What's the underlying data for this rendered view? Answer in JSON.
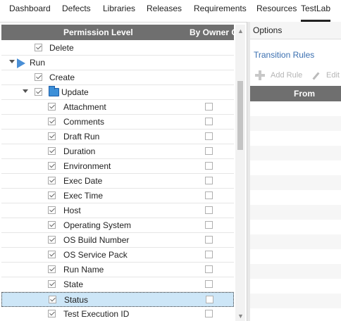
{
  "tabs": [
    {
      "label": "Dashboard"
    },
    {
      "label": "Defects"
    },
    {
      "label": "Libraries"
    },
    {
      "label": "Releases"
    },
    {
      "label": "Requirements"
    },
    {
      "label": "Resources"
    },
    {
      "label": "TestLab",
      "active": true
    }
  ],
  "grid": {
    "header_permission": "Permission Level",
    "header_owner": "By Owner O",
    "rows": [
      {
        "label": "Delete",
        "level": 1,
        "checked": true,
        "owner": false
      },
      {
        "label": "Run",
        "level": 0,
        "group": "run",
        "expanded": true
      },
      {
        "label": "Create",
        "level": 1,
        "checked": true,
        "owner": false
      },
      {
        "label": "Update",
        "level": 1,
        "group": "folder",
        "expanded": true,
        "checked": true
      },
      {
        "label": "Attachment",
        "level": 2,
        "checked": true,
        "owner": true
      },
      {
        "label": "Comments",
        "level": 2,
        "checked": true,
        "owner": true
      },
      {
        "label": "Draft Run",
        "level": 2,
        "checked": true,
        "owner": true
      },
      {
        "label": "Duration",
        "level": 2,
        "checked": true,
        "owner": true
      },
      {
        "label": "Environment",
        "level": 2,
        "checked": true,
        "owner": true
      },
      {
        "label": "Exec Date",
        "level": 2,
        "checked": true,
        "owner": true
      },
      {
        "label": "Exec Time",
        "level": 2,
        "checked": true,
        "owner": true
      },
      {
        "label": "Host",
        "level": 2,
        "checked": true,
        "owner": true
      },
      {
        "label": "Operating System",
        "level": 2,
        "checked": true,
        "owner": true
      },
      {
        "label": "OS Build Number",
        "level": 2,
        "checked": true,
        "owner": true
      },
      {
        "label": "OS Service Pack",
        "level": 2,
        "checked": true,
        "owner": true
      },
      {
        "label": "Run Name",
        "level": 2,
        "checked": true,
        "owner": true
      },
      {
        "label": "State",
        "level": 2,
        "checked": true,
        "owner": true
      },
      {
        "label": "Status",
        "level": 2,
        "checked": true,
        "owner": true,
        "selected": true
      },
      {
        "label": "Test Execution ID",
        "level": 2,
        "checked": true,
        "owner": true
      }
    ]
  },
  "right": {
    "options_label": "Options",
    "transition_rules": "Transition Rules",
    "add_rule": "Add Rule",
    "edit": "Edit",
    "from_header": "From"
  },
  "colors": {
    "header_bg": "#6f6f6f",
    "selected_bg": "#cde6f7",
    "link": "#3a6fb0"
  }
}
